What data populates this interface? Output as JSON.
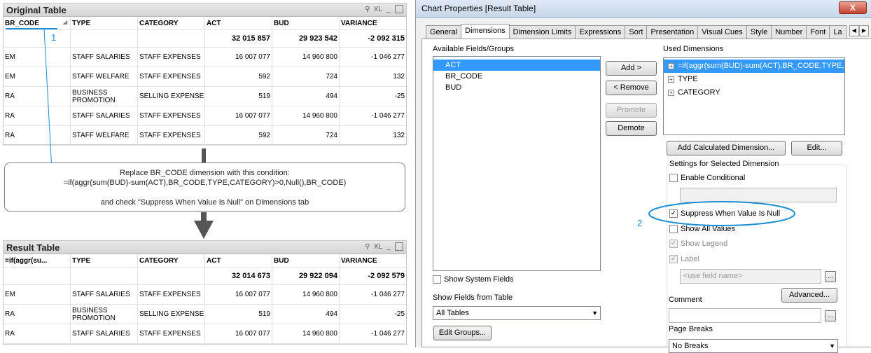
{
  "original_table": {
    "title": "Original Table",
    "icons": [
      "lock-icon",
      "xl-export-icon",
      "minimize-icon",
      "maximize-icon"
    ],
    "xl_label": "XL",
    "columns": [
      "BR_CODE",
      "TYPE",
      "CATEGORY",
      "ACT",
      "BUD",
      "VARIANCE"
    ],
    "totals": [
      "",
      "",
      "",
      "32 015 857",
      "29 923 542",
      "-2 092 315"
    ],
    "rows": [
      [
        "EM",
        "STAFF SALARIES",
        "STAFF EXPENSES",
        "16 007 077",
        "14 960 800",
        "-1 046 277"
      ],
      [
        "EM",
        "STAFF WELFARE",
        "STAFF EXPENSES",
        "592",
        "724",
        "132"
      ],
      [
        "RA",
        "BUSINESS PROMOTION",
        "SELLING EXPENSE",
        "519",
        "494",
        "-25"
      ],
      [
        "RA",
        "STAFF SALARIES",
        "STAFF EXPENSES",
        "16 007 077",
        "14 960 800",
        "-1 046 277"
      ],
      [
        "RA",
        "STAFF WELFARE",
        "STAFF EXPENSES",
        "592",
        "724",
        "132"
      ]
    ]
  },
  "callout_1": "1",
  "callout_2": "2",
  "instruction": {
    "line1": "Replace BR_CODE dimension with this condition:",
    "line2": "=if(aggr(sum(BUD)-sum(ACT),BR_CODE,TYPE,CATEGORY)>0,Null(),BR_CODE)",
    "line3": "and check \"Suppress When Value Is Null\" on Dimensions tab"
  },
  "result_table": {
    "title": "Result Table",
    "xl_label": "XL",
    "columns": [
      "=if(aggr(su...",
      "TYPE",
      "CATEGORY",
      "ACT",
      "BUD",
      "VARIANCE"
    ],
    "totals": [
      "",
      "",
      "",
      "32 014 673",
      "29 922 094",
      "-2 092 579"
    ],
    "rows": [
      [
        "EM",
        "STAFF SALARIES",
        "STAFF EXPENSES",
        "16 007 077",
        "14 960 800",
        "-1 046 277"
      ],
      [
        "RA",
        "BUSINESS PROMOTION",
        "SELLING EXPENSE",
        "519",
        "494",
        "-25"
      ],
      [
        "RA",
        "STAFF SALARIES",
        "STAFF EXPENSES",
        "16 007 077",
        "14 960 800",
        "-1 046 277"
      ]
    ]
  },
  "dialog": {
    "title": "Chart Properties [Result Table]",
    "close_label": "X",
    "tabs": [
      "General",
      "Dimensions",
      "Dimension Limits",
      "Expressions",
      "Sort",
      "Presentation",
      "Visual Cues",
      "Style",
      "Number",
      "Font",
      "La"
    ],
    "active_tab": "Dimensions",
    "available_label": "Available Fields/Groups",
    "available_items": [
      "ACT",
      "BR_CODE",
      "BUD"
    ],
    "add_button": "Add >",
    "remove_button": "< Remove",
    "promote_button": "Promote",
    "demote_button": "Demote",
    "used_label": "Used Dimensions",
    "used_items": [
      "=if(aggr(sum(BUD)-sum(ACT),BR_CODE,TYPE,CATEGORY)>0,Null(),BR_CODE)",
      "TYPE",
      "CATEGORY"
    ],
    "add_calculated_button": "Add Calculated Dimension...",
    "edit_button": "Edit...",
    "settings_group": "Settings for Selected Dimension",
    "enable_conditional": "Enable Conditional",
    "suppress_null": "Suppress When Value Is Null",
    "show_all_values": "Show All Values",
    "show_legend": "Show Legend",
    "label_check": "Label",
    "label_placeholder": "<use field name>",
    "ellipsis": "...",
    "advanced_button": "Advanced...",
    "comment_label": "Comment",
    "page_breaks_label": "Page Breaks",
    "page_breaks_value": "No Breaks",
    "show_system_fields": "Show System Fields",
    "show_fields_label": "Show Fields from Table",
    "show_fields_value": "All Tables",
    "edit_groups_button": "Edit Groups..."
  }
}
